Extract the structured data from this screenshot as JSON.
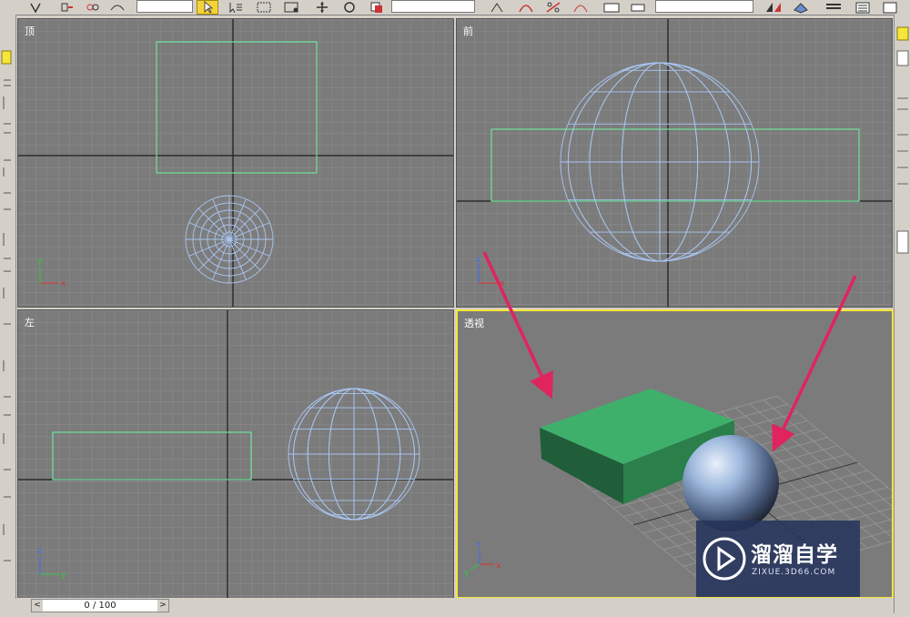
{
  "viewports": {
    "top": {
      "label": "顶"
    },
    "front": {
      "label": "前"
    },
    "left": {
      "label": "左"
    },
    "perspective": {
      "label": "透视"
    }
  },
  "axis_labels": {
    "x": "x",
    "y": "y",
    "z": "z"
  },
  "timeline": {
    "frame_text": "0 / 100",
    "prev_icon": "<",
    "next_icon": ">"
  },
  "watermark": {
    "title": "溜溜自学",
    "subtitle": "ZIXUE.3D66.COM"
  },
  "colors": {
    "viewport_bg": "#7b7b7b",
    "grid": "#8c8c8c",
    "active_border": "#f6e53a",
    "box_wire": "#6fe29a",
    "sphere_wire": "#a9c6f2",
    "box_solid": "#3fb06c",
    "arrow": "#e0245e"
  },
  "icons": [
    "select-object-icon",
    "select-by-name-icon",
    "rect-region-icon",
    "window-crossing-icon",
    "move-icon",
    "rotate-icon",
    "scale-icon",
    "mirror-icon",
    "align-icon",
    "named-selection-icon"
  ]
}
